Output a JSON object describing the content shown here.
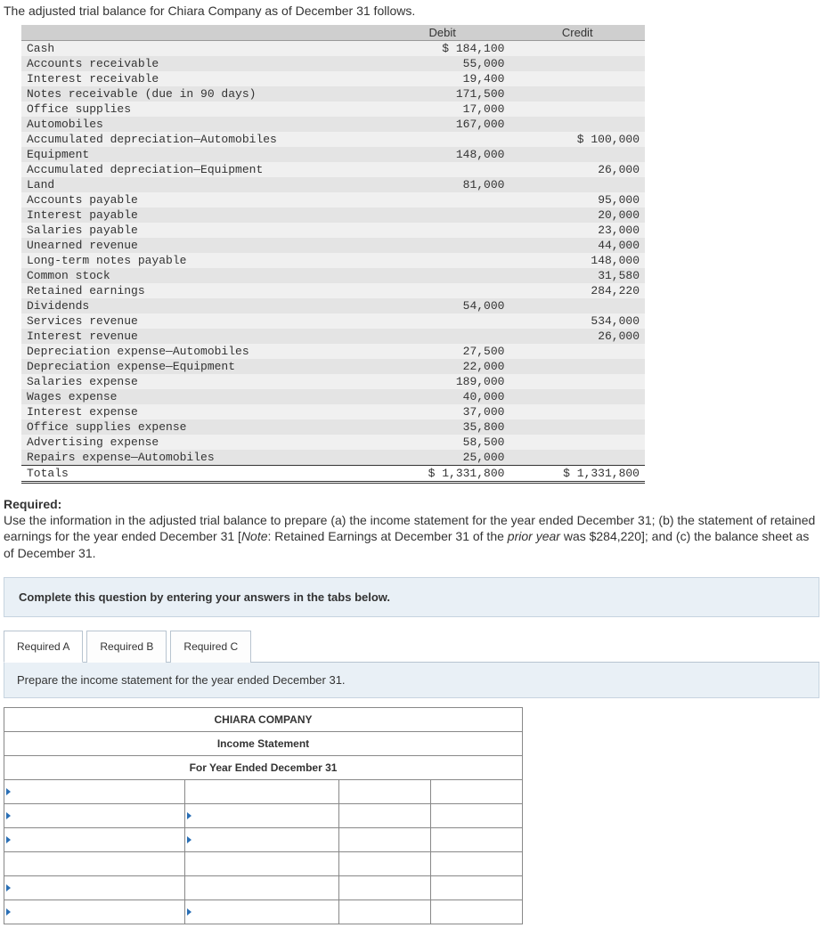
{
  "intro": "The adjusted trial balance for Chiara Company as of December 31 follows.",
  "tb_headers": {
    "account": "",
    "debit": "Debit",
    "credit": "Credit"
  },
  "trial_balance_rows": [
    {
      "account": "Cash",
      "debit": "$ 184,100",
      "credit": ""
    },
    {
      "account": "Accounts receivable",
      "debit": "55,000",
      "credit": ""
    },
    {
      "account": "Interest receivable",
      "debit": "19,400",
      "credit": ""
    },
    {
      "account": "Notes receivable (due in 90 days)",
      "debit": "171,500",
      "credit": ""
    },
    {
      "account": "Office supplies",
      "debit": "17,000",
      "credit": ""
    },
    {
      "account": "Automobiles",
      "debit": "167,000",
      "credit": ""
    },
    {
      "account": "Accumulated depreciation—Automobiles",
      "debit": "",
      "credit": "$ 100,000"
    },
    {
      "account": "Equipment",
      "debit": "148,000",
      "credit": ""
    },
    {
      "account": "Accumulated depreciation—Equipment",
      "debit": "",
      "credit": "26,000"
    },
    {
      "account": "Land",
      "debit": "81,000",
      "credit": ""
    },
    {
      "account": "Accounts payable",
      "debit": "",
      "credit": "95,000"
    },
    {
      "account": "Interest payable",
      "debit": "",
      "credit": "20,000"
    },
    {
      "account": "Salaries payable",
      "debit": "",
      "credit": "23,000"
    },
    {
      "account": "Unearned revenue",
      "debit": "",
      "credit": "44,000"
    },
    {
      "account": "Long-term notes payable",
      "debit": "",
      "credit": "148,000"
    },
    {
      "account": "Common stock",
      "debit": "",
      "credit": "31,580"
    },
    {
      "account": "Retained earnings",
      "debit": "",
      "credit": "284,220"
    },
    {
      "account": "Dividends",
      "debit": "54,000",
      "credit": ""
    },
    {
      "account": "Services revenue",
      "debit": "",
      "credit": "534,000"
    },
    {
      "account": "Interest revenue",
      "debit": "",
      "credit": "26,000"
    },
    {
      "account": "Depreciation expense—Automobiles",
      "debit": "27,500",
      "credit": ""
    },
    {
      "account": "Depreciation expense—Equipment",
      "debit": "22,000",
      "credit": ""
    },
    {
      "account": "Salaries expense",
      "debit": "189,000",
      "credit": ""
    },
    {
      "account": "Wages expense",
      "debit": "40,000",
      "credit": ""
    },
    {
      "account": "Interest expense",
      "debit": "37,000",
      "credit": ""
    },
    {
      "account": "Office supplies expense",
      "debit": "35,800",
      "credit": ""
    },
    {
      "account": "Advertising expense",
      "debit": "58,500",
      "credit": ""
    },
    {
      "account": "Repairs expense—Automobiles",
      "debit": "25,000",
      "credit": ""
    }
  ],
  "totals": {
    "label": "Totals",
    "debit": "$ 1,331,800",
    "credit": "$ 1,331,800"
  },
  "required": {
    "heading": "Required:",
    "text_pre": "Use the information in the adjusted trial balance to prepare (a) the income statement for the year ended December 31; (b) the statement of retained earnings for the year ended December 31 [",
    "note_label": "Note",
    "text_mid": ": Retained Earnings at December 31 of the ",
    "italic": "prior year",
    "text_post": " was $284,220]; and (c) the balance sheet as of December 31."
  },
  "instruction": "Complete this question by entering your answers in the tabs below.",
  "tabs": [
    {
      "label": "Required A",
      "active": true
    },
    {
      "label": "Required B",
      "active": false
    },
    {
      "label": "Required C",
      "active": false
    }
  ],
  "tab_instruction": "Prepare the income statement for the year ended December 31.",
  "worksheet_headers": {
    "company": "CHIARA COMPANY",
    "title": "Income Statement",
    "period": "For Year Ended December 31"
  }
}
